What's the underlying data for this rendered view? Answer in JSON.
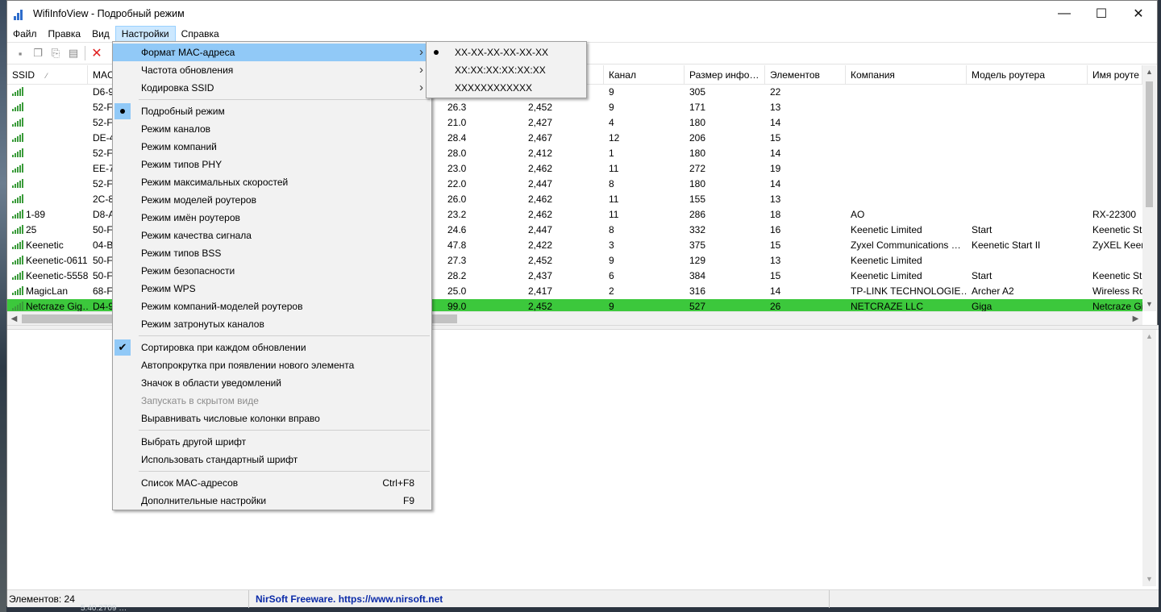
{
  "window": {
    "title": "WifiInfoView  -  Подробный режим",
    "minimize": "—",
    "maximize": "☐",
    "close": "✕"
  },
  "menubar": [
    "Файл",
    "Правка",
    "Вид",
    "Настройки",
    "Справка"
  ],
  "columns": [
    {
      "label": "SSID",
      "width": 100
    },
    {
      "label": "MAC",
      "width": 440
    },
    {
      "label": "",
      "width": 100
    },
    {
      "label": "",
      "width": 100
    },
    {
      "label": "Канал",
      "width": 100
    },
    {
      "label": "Размер инфо…",
      "width": 100
    },
    {
      "label": "Элементов",
      "width": 100
    },
    {
      "label": "Компания",
      "width": 150
    },
    {
      "label": "Модель роутера",
      "width": 150
    },
    {
      "label": "Имя роуте",
      "width": 68
    }
  ],
  "rows": [
    {
      "ssid": "",
      "mac": "D6-9",
      "rssi": "",
      "freq": "",
      "channel": "9",
      "info": "305",
      "elements": "22",
      "company": "",
      "model": "",
      "name": ""
    },
    {
      "ssid": "",
      "mac": "52-F",
      "rssi": "26.3",
      "freq": "2,452",
      "channel": "9",
      "info": "171",
      "elements": "13",
      "company": "",
      "model": "",
      "name": ""
    },
    {
      "ssid": "",
      "mac": "52-F",
      "rssi": "21.0",
      "freq": "2,427",
      "channel": "4",
      "info": "180",
      "elements": "14",
      "company": "",
      "model": "",
      "name": ""
    },
    {
      "ssid": "",
      "mac": "DE-4",
      "rssi": "28.4",
      "freq": "2,467",
      "channel": "12",
      "info": "206",
      "elements": "15",
      "company": "",
      "model": "",
      "name": ""
    },
    {
      "ssid": "",
      "mac": "52-F",
      "rssi": "28.0",
      "freq": "2,412",
      "channel": "1",
      "info": "180",
      "elements": "14",
      "company": "",
      "model": "",
      "name": ""
    },
    {
      "ssid": "",
      "mac": "EE-7",
      "rssi": "23.0",
      "freq": "2,462",
      "channel": "11",
      "info": "272",
      "elements": "19",
      "company": "",
      "model": "",
      "name": ""
    },
    {
      "ssid": "",
      "mac": "52-F",
      "rssi": "22.0",
      "freq": "2,447",
      "channel": "8",
      "info": "180",
      "elements": "14",
      "company": "",
      "model": "",
      "name": ""
    },
    {
      "ssid": "",
      "mac": "2C-8",
      "rssi": "26.0",
      "freq": "2,462",
      "channel": "11",
      "info": "155",
      "elements": "13",
      "company": "",
      "model": "",
      "name": ""
    },
    {
      "ssid": "1-89",
      "mac": "D8-A",
      "rssi": "23.2",
      "freq": "2,462",
      "channel": "11",
      "info": "286",
      "elements": "18",
      "company": "AO",
      "model": "",
      "name": "RX-22300"
    },
    {
      "ssid": "25",
      "mac": "50-F",
      "rssi": "24.6",
      "freq": "2,447",
      "channel": "8",
      "info": "332",
      "elements": "16",
      "company": "Keenetic Limited",
      "model": "Start",
      "name": "Keenetic St"
    },
    {
      "ssid": "Keenetic",
      "mac": "04-B",
      "rssi": "47.8",
      "freq": "2,422",
      "channel": "3",
      "info": "375",
      "elements": "15",
      "company": "Zyxel Communications …",
      "model": "Keenetic Start II",
      "name": "ZyXEL Keer"
    },
    {
      "ssid": "Keenetic-0611",
      "mac": "50-F",
      "rssi": "27.3",
      "freq": "2,452",
      "channel": "9",
      "info": "129",
      "elements": "13",
      "company": "Keenetic Limited",
      "model": "",
      "name": ""
    },
    {
      "ssid": "Keenetic-5558",
      "mac": "50-F",
      "rssi": "28.2",
      "freq": "2,437",
      "channel": "6",
      "info": "384",
      "elements": "15",
      "company": "Keenetic Limited",
      "model": "Start",
      "name": "Keenetic St"
    },
    {
      "ssid": "MagicLan",
      "mac": "68-F",
      "rssi": "25.0",
      "freq": "2,417",
      "channel": "2",
      "info": "316",
      "elements": "14",
      "company": "TP-LINK TECHNOLOGIE…",
      "model": "Archer A2",
      "name": "Wireless Ro"
    },
    {
      "ssid": "Netcraze Gig…",
      "mac": "D4-9",
      "rssi": "99.0",
      "freq": "2,452",
      "channel": "9",
      "info": "527",
      "elements": "26",
      "company": "NETCRAZE LLC",
      "model": "Giga",
      "name": "Netcraze Gi",
      "selected": true
    }
  ],
  "settings_menu": {
    "items": [
      {
        "label": "Формат MAC-адреса",
        "submenu": true,
        "highlighted": true
      },
      {
        "label": "Частота обновления",
        "submenu": true
      },
      {
        "label": "Кодировка SSID",
        "submenu": true
      },
      {
        "sep": true
      },
      {
        "label": "Подробный режим",
        "radio": true
      },
      {
        "label": "Режим каналов"
      },
      {
        "label": "Режим компаний"
      },
      {
        "label": "Режим типов PHY"
      },
      {
        "label": "Режим максимальных скоростей"
      },
      {
        "label": "Режим моделей роутеров"
      },
      {
        "label": "Режим имён роутеров"
      },
      {
        "label": "Режим качества сигнала"
      },
      {
        "label": "Режим типов BSS"
      },
      {
        "label": "Режим безопасности"
      },
      {
        "label": "Режим WPS"
      },
      {
        "label": "Режим компаний-моделей роутеров"
      },
      {
        "label": "Режим затронутых каналов"
      },
      {
        "sep": true
      },
      {
        "label": "Сортировка при каждом обновлении",
        "check": true
      },
      {
        "label": "Автопрокрутка при появлении нового элемента"
      },
      {
        "label": "Значок в области уведомлений"
      },
      {
        "label": "Запускать в скрытом виде",
        "disabled": true
      },
      {
        "label": "Выравнивать числовые колонки вправо"
      },
      {
        "sep": true
      },
      {
        "label": "Выбрать другой шрифт"
      },
      {
        "label": "Использовать стандартный шрифт"
      },
      {
        "sep": true
      },
      {
        "label": "Список MAC-адресов",
        "shortcut": "Ctrl+F8"
      },
      {
        "label": "Дополнительные настройки",
        "shortcut": "F9"
      }
    ]
  },
  "mac_format_submenu": [
    {
      "label": "XX-XX-XX-XX-XX-XX",
      "radio": true
    },
    {
      "label": "XX:XX:XX:XX:XX:XX"
    },
    {
      "label": "XXXXXXXXXXXX"
    }
  ],
  "status": {
    "count": "Элементов: 24",
    "link": "NirSoft Freeware. https://www.nirsoft.net"
  },
  "taskbar_hint": "5.40.2709 …"
}
